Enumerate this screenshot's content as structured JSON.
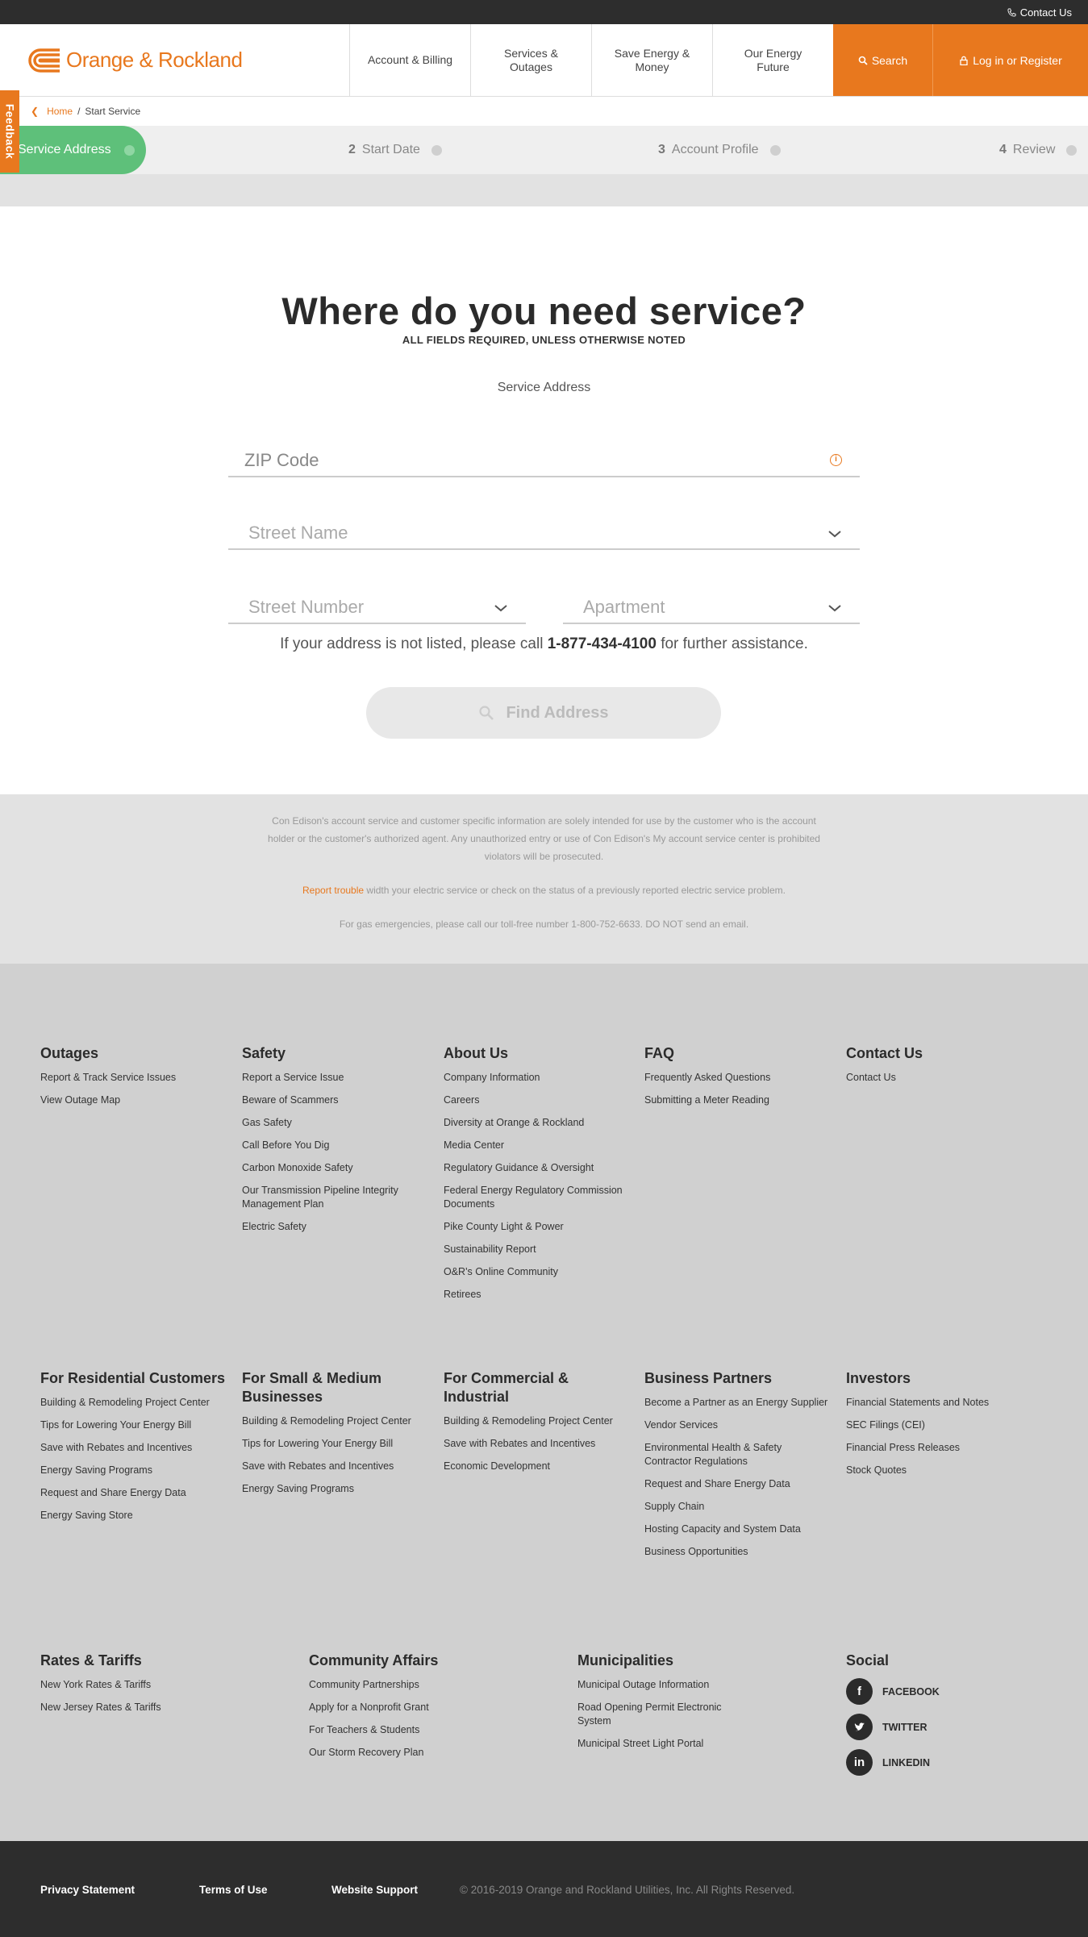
{
  "utility": {
    "contact_label": "Contact Us"
  },
  "header": {
    "logo_text": "Orange & Rockland",
    "nav": [
      "Account & Billing",
      "Services & Outages",
      "Save Energy & Money",
      "Our Energy Future"
    ],
    "search_label": "Search",
    "login_label": "Log in or Register"
  },
  "breadcrumb": {
    "home": "Home",
    "separator": "/",
    "current": "Start Service"
  },
  "feedback_label": "Feedback",
  "steps": {
    "active": "Service Address",
    "items": [
      {
        "num": "2",
        "label": "Start Date"
      },
      {
        "num": "3",
        "label": "Account Profile"
      },
      {
        "num": "4",
        "label": "Review"
      }
    ]
  },
  "form": {
    "title": "Where do you need service?",
    "subtitle": "ALL FIELDS REQUIRED, UNLESS OTHERWISE NOTED",
    "section_label": "Service Address",
    "zip_placeholder": "ZIP Code",
    "zip_info_icon": "i",
    "street_name_placeholder": "Street Name",
    "street_number_placeholder": "Street Number",
    "apartment_placeholder": "Apartment",
    "assist_before": "If your address is not listed, please call",
    "assist_phone": "1-877-434-4100",
    "assist_after": "for further assistance.",
    "find_button": "Find Address"
  },
  "disclaimer": {
    "text": "Con Edison's account service and customer specific information are solely intended for use by the customer who is the account holder or the customer's authorized agent. Any unauthorized entry or use of Con Edison's My account service center is prohibited violators will be prosecuted.",
    "report_link": "Report trouble",
    "report_text": "width your electric service or check on the status of a previously reported electric service problem.",
    "gas_text": "For gas emergencies, please call our toll-free number 1-800-752-6633. DO NOT send an email."
  },
  "footer": {
    "outages": {
      "title": "Outages",
      "links": [
        "Report & Track Service Issues",
        "View Outage Map"
      ]
    },
    "safety": {
      "title": "Safety",
      "links": [
        "Report a Service Issue",
        "Beware of Scammers",
        "Gas Safety",
        "Call Before You Dig",
        "Carbon Monoxide Safety",
        "Our Transmission Pipeline Integrity Management Plan",
        "Electric Safety"
      ]
    },
    "about": {
      "title": "About Us",
      "links": [
        "Company Information",
        "Careers",
        "Diversity at Orange & Rockland",
        "Media Center",
        "Regulatory Guidance & Oversight",
        "Federal Energy Regulatory Commission Documents",
        "Pike County Light & Power",
        "Sustainability Report",
        "O&R's Online Community",
        "Retirees"
      ]
    },
    "faq": {
      "title": "FAQ",
      "links": [
        "Frequently Asked Questions",
        "Submitting a Meter Reading"
      ]
    },
    "contact": {
      "title": "Contact Us",
      "links": [
        "Contact Us"
      ]
    },
    "residential": {
      "title": "For Residential Customers",
      "links": [
        "Building & Remodeling Project Center",
        "Tips for Lowering Your Energy Bill",
        "Save with Rebates and Incentives",
        "Energy Saving Programs",
        "Request and Share Energy Data",
        "Energy Saving Store"
      ]
    },
    "small_business": {
      "title": "For Small & Medium Businesses",
      "links": [
        "Building & Remodeling Project Center",
        "Tips for Lowering Your Energy Bill",
        "Save with Rebates and Incentives",
        "Energy Saving Programs"
      ]
    },
    "commercial": {
      "title": "For Commercial & Industrial",
      "links": [
        "Building & Remodeling Project Center",
        "Save with Rebates and Incentives",
        "Economic Development"
      ]
    },
    "partners": {
      "title": "Business Partners",
      "links": [
        "Become a Partner as an Energy Supplier",
        "Vendor Services",
        "Environmental Health & Safety Contractor Regulations",
        "Request and Share Energy Data",
        "Supply Chain",
        "Hosting Capacity and System Data",
        "Business Opportunities"
      ]
    },
    "investors": {
      "title": "Investors",
      "links": [
        "Financial Statements and Notes",
        "SEC Filings (CEI)",
        "Financial Press Releases",
        "Stock Quotes"
      ]
    },
    "rates": {
      "title": "Rates & Tariffs",
      "links": [
        "New York Rates & Tariffs",
        "New Jersey Rates & Tariffs"
      ]
    },
    "community": {
      "title": "Community Affairs",
      "links": [
        "Community Partnerships",
        "Apply for a Nonprofit Grant",
        "For Teachers & Students",
        "Our Storm Recovery Plan"
      ]
    },
    "municipalities": {
      "title": "Municipalities",
      "links": [
        "Municipal Outage Information",
        "Road Opening Permit Electronic System",
        "Municipal Street Light Portal"
      ]
    },
    "social": {
      "title": "Social",
      "items": [
        {
          "label": "FACEBOOK",
          "glyph": "f",
          "icon": "facebook-icon"
        },
        {
          "label": "TWITTER",
          "glyph": "t",
          "icon": "twitter-icon"
        },
        {
          "label": "LINKEDIN",
          "glyph": "in",
          "icon": "linkedin-icon"
        }
      ]
    }
  },
  "bottom": {
    "privacy": "Privacy Statement",
    "terms": "Terms of Use",
    "support": "Website Support",
    "copyright": "© 2016-2019 Orange and Rockland Utilities, Inc. All Rights Reserved."
  },
  "colors": {
    "brand_orange": "#e8781e",
    "step_active_green": "#5ec07a",
    "dark": "#2d2d2d"
  }
}
